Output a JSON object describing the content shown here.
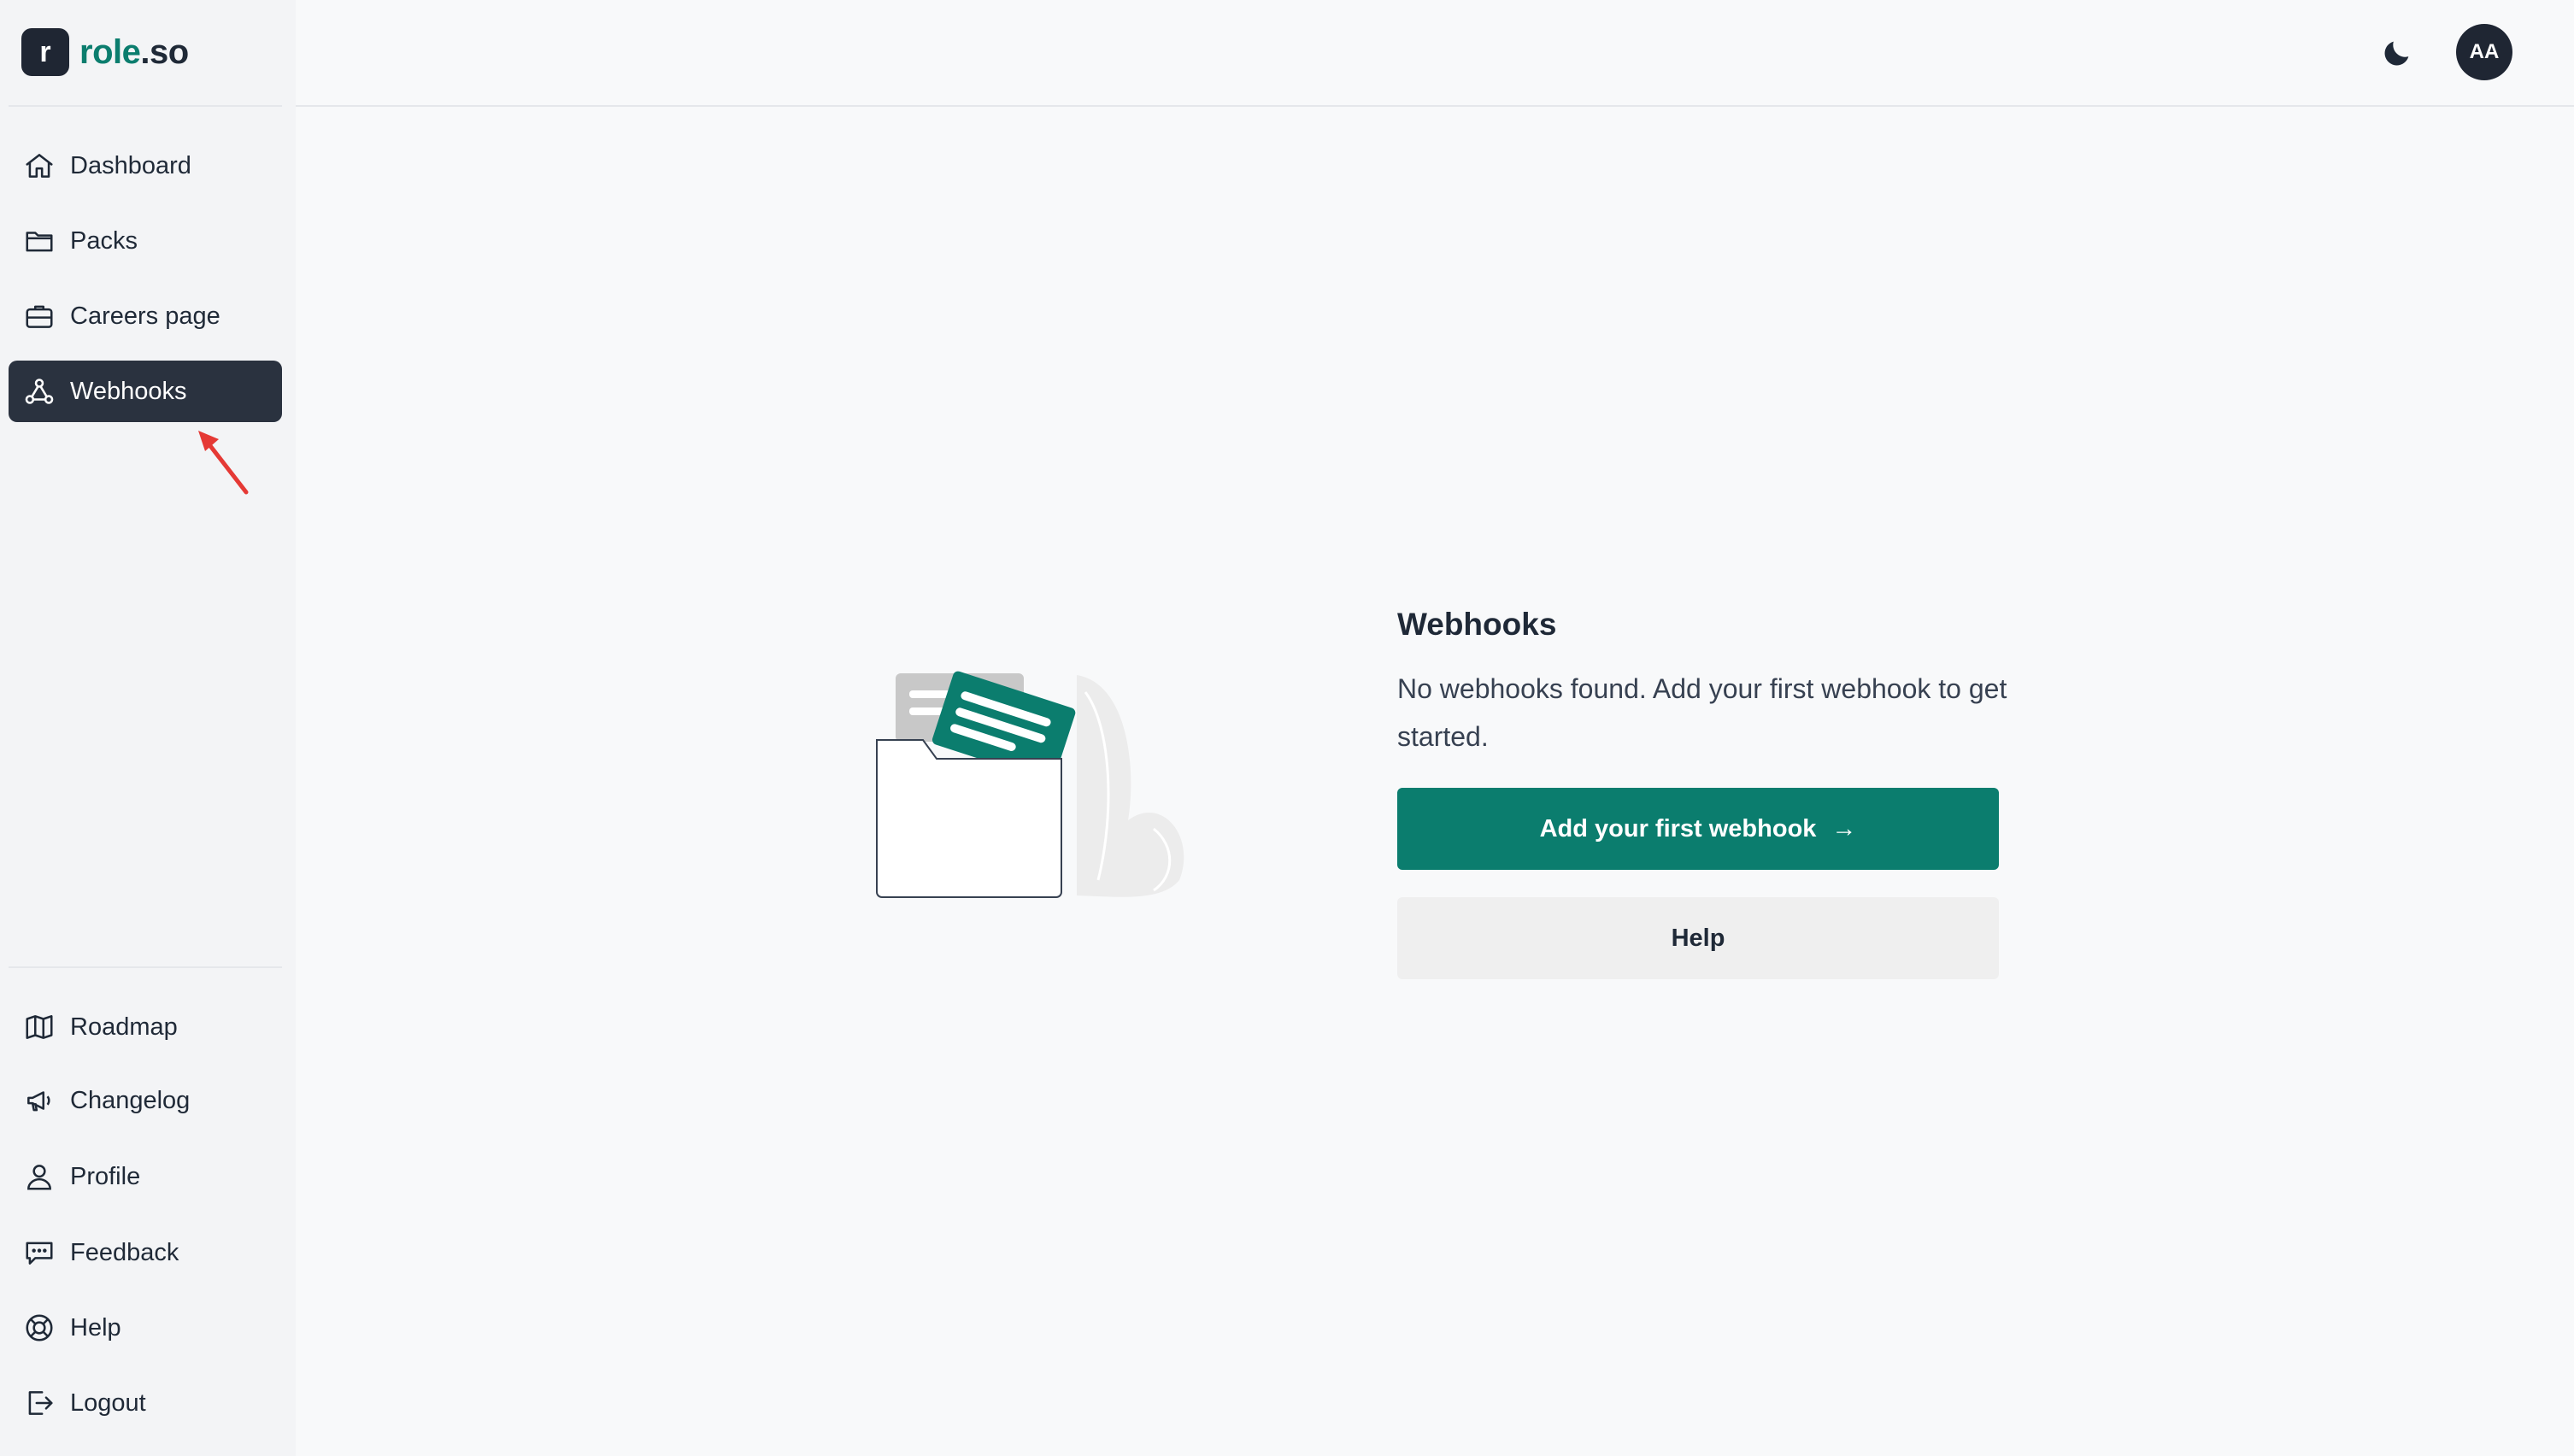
{
  "brand": {
    "logo_letter": "r",
    "name_primary": "role",
    "name_suffix": ".so",
    "accent": "#0b7d6e"
  },
  "sidebar": {
    "main_items": [
      {
        "label": "Dashboard",
        "icon": "home-icon"
      },
      {
        "label": "Packs",
        "icon": "folder-icon"
      },
      {
        "label": "Careers page",
        "icon": "briefcase-icon"
      },
      {
        "label": "Webhooks",
        "icon": "webhook-icon",
        "active": true
      }
    ],
    "footer_items": [
      {
        "label": "Roadmap",
        "icon": "map-icon"
      },
      {
        "label": "Changelog",
        "icon": "megaphone-icon"
      },
      {
        "label": "Profile",
        "icon": "user-icon"
      },
      {
        "label": "Feedback",
        "icon": "chat-bubble-icon"
      },
      {
        "label": "Help",
        "icon": "lifebuoy-icon"
      },
      {
        "label": "Logout",
        "icon": "logout-icon"
      }
    ]
  },
  "header": {
    "theme_toggle_icon": "moon-icon",
    "avatar_initials": "AA"
  },
  "empty_state": {
    "title": "Webhooks",
    "description": "No webhooks found. Add your first webhook to get started.",
    "primary_button": "Add your first webhook",
    "primary_button_arrow": "→",
    "secondary_button": "Help"
  },
  "colors": {
    "sidebar_active_bg": "#2a323f",
    "annotation_arrow": "#e53935"
  }
}
